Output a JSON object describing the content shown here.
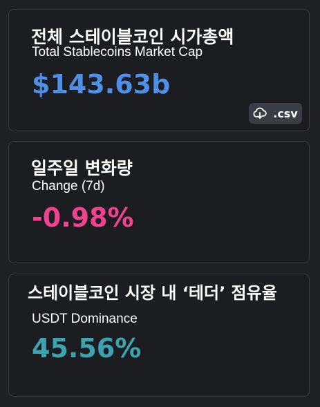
{
  "cards": [
    {
      "title_ko": "전체 스테이블코인 시가총액",
      "title_en": "Total Stablecoins Market Cap",
      "value": "$143.63b",
      "value_color": "#4f8fe6",
      "download": {
        "label": ".csv",
        "icon": "cloud-download-icon"
      }
    },
    {
      "title_ko": "일주일 변화량",
      "title_en": "Change (7d)",
      "value": "-0.98%",
      "value_color": "#f0438f"
    },
    {
      "title_ko": "스테이블코인 시장 내 ‘테더’ 점유율",
      "title_en": "USDT Dominance",
      "value": "45.56%",
      "value_color": "#3ea3b0"
    }
  ]
}
